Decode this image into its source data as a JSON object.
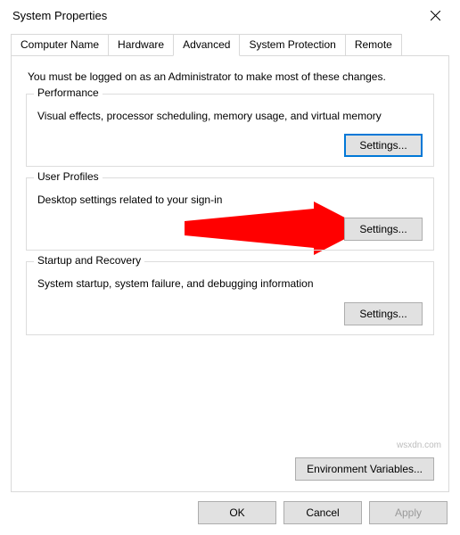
{
  "window": {
    "title": "System Properties"
  },
  "tabs": {
    "items": [
      {
        "label": "Computer Name",
        "active": false
      },
      {
        "label": "Hardware",
        "active": false
      },
      {
        "label": "Advanced",
        "active": true
      },
      {
        "label": "System Protection",
        "active": false
      },
      {
        "label": "Remote",
        "active": false
      }
    ]
  },
  "intro": "You must be logged on as an Administrator to make most of these changes.",
  "groups": {
    "performance": {
      "legend": "Performance",
      "desc": "Visual effects, processor scheduling, memory usage, and virtual memory",
      "button": "Settings..."
    },
    "userProfiles": {
      "legend": "User Profiles",
      "desc": "Desktop settings related to your sign-in",
      "button": "Settings..."
    },
    "startupRecovery": {
      "legend": "Startup and Recovery",
      "desc": "System startup, system failure, and debugging information",
      "button": "Settings..."
    }
  },
  "envVarsButton": "Environment Variables...",
  "dialogButtons": {
    "ok": "OK",
    "cancel": "Cancel",
    "apply": "Apply"
  },
  "watermark": "wsxdn.com",
  "annotation": {
    "arrowColor": "#ff0000"
  }
}
